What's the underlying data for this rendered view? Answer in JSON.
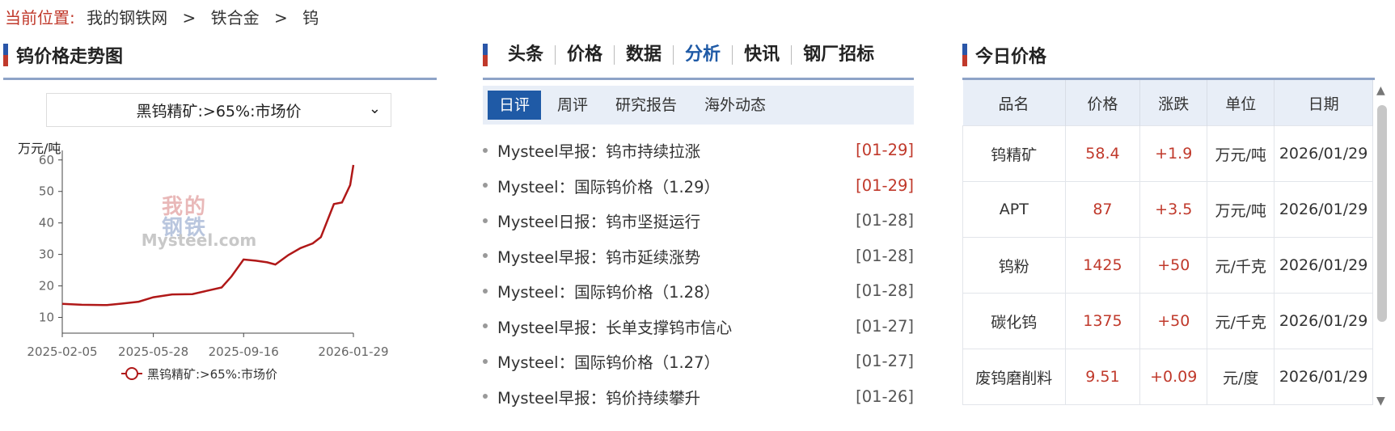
{
  "breadcrumb": {
    "lead": "当前位置:",
    "items": [
      "我的钢铁网",
      "铁合金",
      "钨"
    ],
    "sep": ">"
  },
  "left": {
    "title": "钨价格走势图",
    "select_value": "黑钨精矿:>65%:市场价",
    "unit": "万元/吨",
    "watermark_top": "我的钢铁",
    "watermark_bottom": "Mysteel.com",
    "legend": "黑钨精矿:>65%:市场价"
  },
  "chart_data": {
    "type": "line",
    "title": "",
    "ylabel": "万元/吨",
    "ylim": [
      5,
      62
    ],
    "yticks": [
      10,
      20,
      30,
      40,
      50,
      60
    ],
    "xticks": [
      "2025-02-05",
      "2025-05-28",
      "2025-09-16",
      "2026-01-29"
    ],
    "color": "#b01818",
    "series": [
      {
        "name": "黑钨精矿:>65%:市场价",
        "x": [
          "2025-02-05",
          "2025-03-01",
          "2025-04-01",
          "2025-04-20",
          "2025-05-10",
          "2025-05-28",
          "2025-06-20",
          "2025-07-15",
          "2025-08-01",
          "2025-08-20",
          "2025-09-01",
          "2025-09-16",
          "2025-10-01",
          "2025-10-15",
          "2025-10-25",
          "2025-11-10",
          "2025-11-25",
          "2025-12-10",
          "2025-12-20",
          "2026-01-05",
          "2026-01-15",
          "2026-01-25",
          "2026-01-29"
        ],
        "y": [
          14.3,
          14.0,
          13.9,
          14.4,
          15.0,
          16.4,
          17.3,
          17.4,
          18.4,
          19.5,
          23.0,
          28.4,
          28.0,
          27.5,
          26.8,
          29.8,
          32.0,
          33.5,
          35.5,
          46.0,
          46.5,
          52.0,
          58.4
        ]
      }
    ]
  },
  "middle": {
    "tabs": [
      "头条",
      "价格",
      "数据",
      "分析",
      "快讯",
      "钢厂招标"
    ],
    "active_tab": "分析",
    "subtabs": [
      "日评",
      "周评",
      "研究报告",
      "海外动态"
    ],
    "news": [
      {
        "title": "Mysteel早报：钨市持续拉涨",
        "date": "[01-29]",
        "hot": true
      },
      {
        "title": "Mysteel：国际钨价格（1.29）",
        "date": "[01-29]",
        "hot": true
      },
      {
        "title": "Mysteel日报：钨市坚挺运行",
        "date": "[01-28]",
        "hot": false
      },
      {
        "title": "Mysteel早报：钨市延续涨势",
        "date": "[01-28]",
        "hot": false
      },
      {
        "title": "Mysteel：国际钨价格（1.28）",
        "date": "[01-28]",
        "hot": false
      },
      {
        "title": "Mysteel早报：长单支撑钨市信心",
        "date": "[01-27]",
        "hot": false
      },
      {
        "title": "Mysteel：国际钨价格（1.27）",
        "date": "[01-27]",
        "hot": false
      },
      {
        "title": "Mysteel早报：钨价持续攀升",
        "date": "[01-26]",
        "hot": false
      }
    ]
  },
  "right": {
    "title": "今日价格",
    "headers": [
      "品名",
      "价格",
      "涨跌",
      "单位",
      "日期"
    ],
    "rows": [
      [
        "钨精矿",
        "58.4",
        "+1.9",
        "万元/吨",
        "2026/01/29"
      ],
      [
        "APT",
        "87",
        "+3.5",
        "万元/吨",
        "2026/01/29"
      ],
      [
        "钨粉",
        "1425",
        "+50",
        "元/千克",
        "2026/01/29"
      ],
      [
        "碳化钨",
        "1375",
        "+50",
        "元/千克",
        "2026/01/29"
      ],
      [
        "废钨磨削料",
        "9.51",
        "+0.09",
        "元/度",
        "2026/01/29"
      ]
    ]
  }
}
